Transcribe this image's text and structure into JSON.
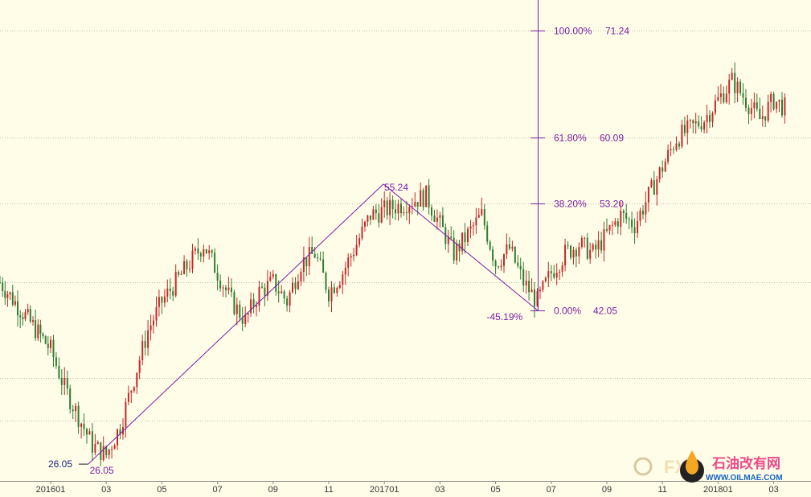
{
  "chart_data": {
    "type": "candlestick",
    "title": "",
    "x_tick_labels": [
      "201601",
      "03",
      "05",
      "07",
      "09",
      "11",
      "201701",
      "03",
      "05",
      "07",
      "09",
      "11",
      "201801",
      "03"
    ],
    "y_range": [
      23,
      76
    ],
    "grid": "horizontal dotted lines",
    "colors": {
      "up": "#c62828",
      "down": "#2e7d32",
      "annotation": "#7b1fa2",
      "grid": "#bdbdad",
      "background": "#fffde8"
    },
    "price_path": [
      [
        "201512",
        45
      ],
      [
        "201601",
        38
      ],
      [
        "201601",
        34
      ],
      [
        "201602",
        31
      ],
      [
        "201602",
        28
      ],
      [
        "201603",
        27
      ],
      [
        "201603",
        30
      ],
      [
        "201604",
        35
      ],
      [
        "201604",
        40
      ],
      [
        "201605",
        43
      ],
      [
        "201605",
        45
      ],
      [
        "201606",
        47
      ],
      [
        "201606",
        49
      ],
      [
        "201607",
        46
      ],
      [
        "201607",
        43
      ],
      [
        "201608",
        41
      ],
      [
        "201608",
        44
      ],
      [
        "201609",
        45
      ],
      [
        "201609",
        43
      ],
      [
        "201610",
        47
      ],
      [
        "201610",
        48
      ],
      [
        "201611",
        44
      ],
      [
        "201611",
        46
      ],
      [
        "201612",
        49
      ],
      [
        "201612",
        52
      ],
      [
        "201701",
        52.5
      ],
      [
        "201701",
        53
      ],
      [
        "201702",
        53.5
      ],
      [
        "201702",
        54
      ],
      [
        "201703",
        51
      ],
      [
        "201703",
        48
      ],
      [
        "201704",
        50
      ],
      [
        "201704",
        52
      ],
      [
        "201705",
        47
      ],
      [
        "201705",
        48.5
      ],
      [
        "201706",
        45
      ],
      [
        "201706",
        43
      ],
      [
        "201707",
        46
      ],
      [
        "201707",
        48
      ],
      [
        "201708",
        49
      ],
      [
        "201708",
        48
      ],
      [
        "201709",
        50
      ],
      [
        "201709",
        52
      ],
      [
        "201710",
        51
      ],
      [
        "201710",
        54
      ],
      [
        "201711",
        57
      ],
      [
        "201711",
        60
      ],
      [
        "201712",
        61
      ],
      [
        "201712",
        62
      ],
      [
        "201801",
        64
      ],
      [
        "201801",
        66
      ],
      [
        "201802",
        64
      ],
      [
        "201802",
        62
      ],
      [
        "201803",
        64
      ],
      [
        "201803",
        63
      ]
    ],
    "trend_points": [
      {
        "date": "201602",
        "value": 26.05,
        "label": "26.05"
      },
      {
        "date": "201701",
        "value": 55.24,
        "label": "55.24"
      },
      {
        "date": "201706",
        "value": 42.05,
        "label": "-45.19%"
      }
    ],
    "left_label": "26.05",
    "fibonacci": [
      {
        "pct": "100.00%",
        "price": "71.24",
        "value": 71.24
      },
      {
        "pct": "61.80%",
        "price": "60.09",
        "value": 60.09
      },
      {
        "pct": "38.20%",
        "price": "53.20",
        "value": 53.2
      },
      {
        "pct": "0.00%",
        "price": "42.05",
        "value": 42.05
      }
    ],
    "gridline_values": [
      71.24,
      60.09,
      53.2,
      45.0,
      35.0
    ],
    "watermark": {
      "text_left": "FX",
      "text_cn": "石油改有网",
      "text_url": "WWW.OILMAE.COM"
    }
  }
}
